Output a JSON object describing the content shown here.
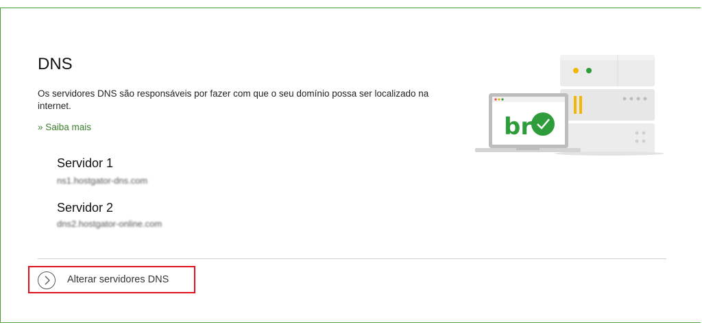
{
  "section": {
    "title": "DNS",
    "description": "Os servidores DNS são responsáveis por fazer com que o seu domínio possa ser localizado na internet.",
    "learn_more": "» Saiba mais"
  },
  "servers": [
    {
      "label": "Servidor 1",
      "value": "ns1.hostgator-dns.com"
    },
    {
      "label": "Servidor 2",
      "value": "dns2.hostgator-online.com"
    }
  ],
  "actions": {
    "change_dns": "Alterar servidores DNS",
    "change_icon": "chevron-right-icon"
  },
  "illustration": {
    "badge_text": "br",
    "icons": [
      "server-icon",
      "laptop-icon",
      "checkmark-icon"
    ]
  },
  "colors": {
    "brand_green": "#3a7d2c",
    "border_green": "#4c9a3a",
    "highlight_red": "#e0101a",
    "accent_yellow": "#f2b705"
  }
}
